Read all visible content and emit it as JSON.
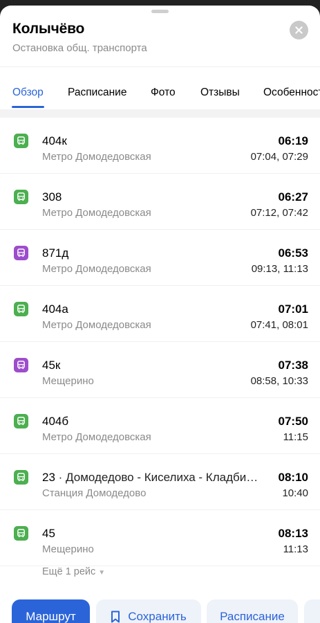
{
  "place": {
    "title": "Колычёво",
    "subtitle": "Остановка общ. транспорта"
  },
  "tabs": [
    "Обзор",
    "Расписание",
    "Фото",
    "Отзывы",
    "Особенности"
  ],
  "colors": {
    "accent": "#2a64d8",
    "bus": "#4caf50",
    "minibus": "#9c4dcc"
  },
  "routes": [
    {
      "number": "404к",
      "dest": "",
      "stop": "Метро Домодедовская",
      "time": "06:19",
      "next": "07:04, 07:29",
      "kind": "bus"
    },
    {
      "number": "308",
      "dest": "",
      "stop": "Метро Домодедовская",
      "time": "06:27",
      "next": "07:12, 07:42",
      "kind": "bus"
    },
    {
      "number": "871д",
      "dest": "",
      "stop": "Метро Домодедовская",
      "time": "06:53",
      "next": "09:13, 11:13",
      "kind": "minibus"
    },
    {
      "number": "404а",
      "dest": "",
      "stop": "Метро Домодедовская",
      "time": "07:01",
      "next": "07:41, 08:01",
      "kind": "bus"
    },
    {
      "number": "45к",
      "dest": "",
      "stop": "Мещерино",
      "time": "07:38",
      "next": "08:58, 10:33",
      "kind": "minibus"
    },
    {
      "number": "404б",
      "dest": "",
      "stop": "Метро Домодедовская",
      "time": "07:50",
      "next": "11:15",
      "kind": "bus"
    },
    {
      "number": "23",
      "dest": " · Домодедово - Киселиха - Кладби…",
      "stop": "Станция Домодедово",
      "time": "08:10",
      "next": "10:40",
      "kind": "bus"
    },
    {
      "number": "45",
      "dest": "",
      "stop": "Мещерино",
      "time": "08:13",
      "next": "11:13",
      "kind": "bus"
    }
  ],
  "more": {
    "label": "Ещё 1 рейс"
  },
  "actions": {
    "route": "Маршрут",
    "save": "Сохранить",
    "schedule": "Расписание"
  }
}
